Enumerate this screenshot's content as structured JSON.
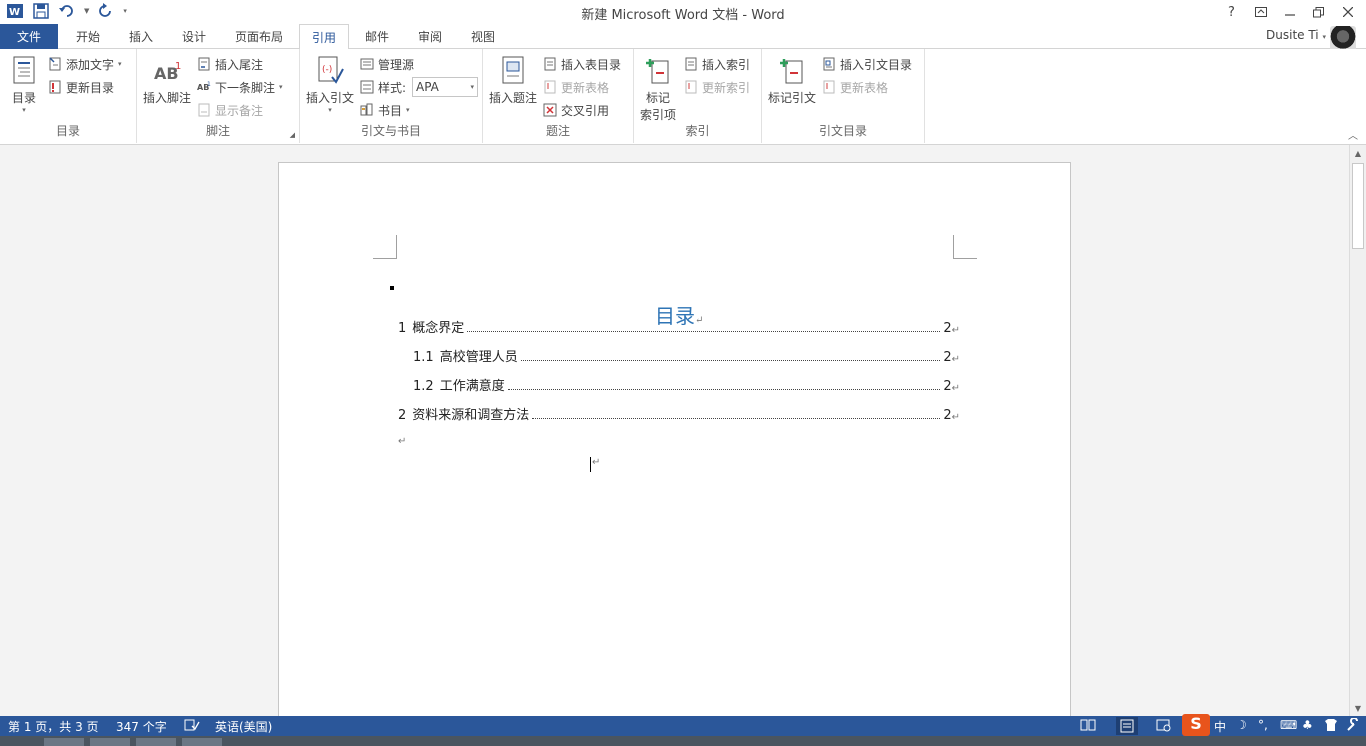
{
  "window": {
    "title": "新建 Microsoft Word 文档 - Word",
    "help": "?",
    "user_name": "Dusite Ti"
  },
  "tabs": [
    {
      "label": "文件"
    },
    {
      "label": "开始"
    },
    {
      "label": "插入"
    },
    {
      "label": "设计"
    },
    {
      "label": "页面布局"
    },
    {
      "label": "引用"
    },
    {
      "label": "邮件"
    },
    {
      "label": "审阅"
    },
    {
      "label": "视图"
    }
  ],
  "ribbon": {
    "toc": {
      "label": "目录",
      "big": "目录",
      "add_text": "添加文字",
      "update_toc": "更新目录"
    },
    "footnotes": {
      "label": "脚注",
      "big": "插入脚注",
      "insert_endnote": "插入尾注",
      "next_footnote": "下一条脚注",
      "show_notes": "显示备注"
    },
    "citations": {
      "label": "引文与书目",
      "big": "插入引文",
      "manage_sources": "管理源",
      "style_label": "样式:",
      "style_value": "APA",
      "bibliography": "书目"
    },
    "captions": {
      "label": "题注",
      "big": "插入题注",
      "insert_tof": "插入表目录",
      "update_table": "更新表格",
      "cross_ref": "交叉引用"
    },
    "index": {
      "label": "索引",
      "big_line1": "标记",
      "big_line2": "索引项",
      "insert_index": "插入索引",
      "update_index": "更新索引"
    },
    "toa": {
      "label": "引文目录",
      "big": "标记引文",
      "insert_toa": "插入引文目录",
      "update_table": "更新表格"
    }
  },
  "document": {
    "toc_title": "目录",
    "entries": [
      {
        "num": "1",
        "text": "概念界定",
        "page": "2"
      },
      {
        "num": "1.1",
        "text": "高校管理人员",
        "page": "2"
      },
      {
        "num": "1.2",
        "text": "工作满意度",
        "page": "2"
      },
      {
        "num": "2",
        "text": "资料来源和调查方法",
        "page": "2"
      }
    ],
    "para_mark": "↵"
  },
  "status": {
    "page": "第 1 页，共 3 页",
    "words": "347 个字",
    "language": "英语(美国)"
  },
  "colors": {
    "accent": "#2b579a",
    "heading": "#2e74b5"
  }
}
